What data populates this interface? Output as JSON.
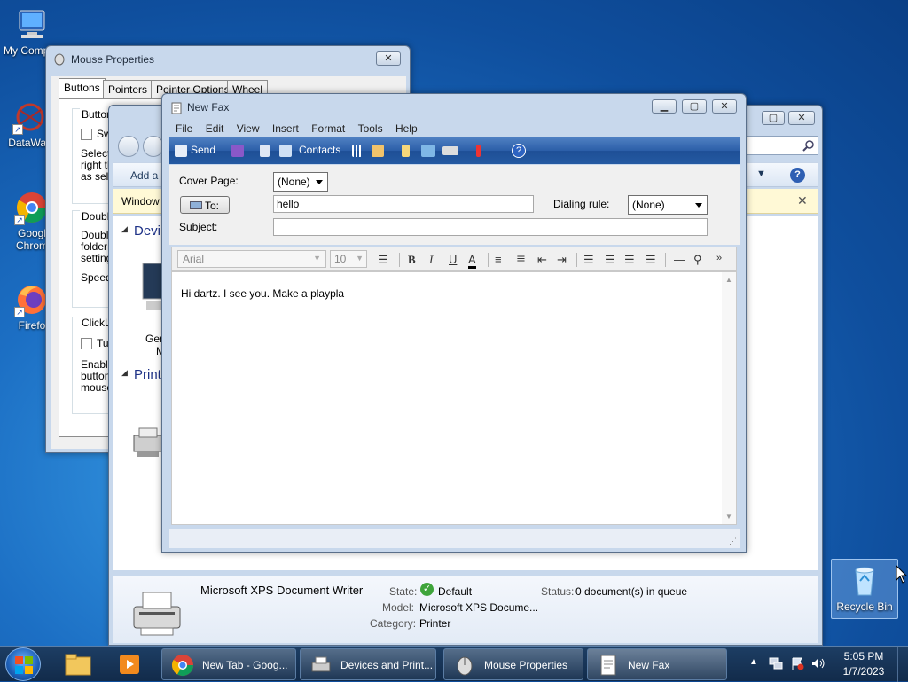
{
  "desktop": {
    "icons": [
      {
        "label": "My Comp"
      },
      {
        "label": "DataWag"
      },
      {
        "label": "Googl\nChrom"
      },
      {
        "label": "Firefo"
      },
      {
        "label": "Recycle Bin"
      }
    ]
  },
  "mouse_properties": {
    "title": "Mouse Properties",
    "tabs": [
      "Buttons",
      "Pointers",
      "Pointer Options",
      "Wheel"
    ],
    "group_button": "Button",
    "switch_label": "Swi",
    "select_text": [
      "Select",
      "right th",
      "as sele"
    ],
    "double_group": "Double",
    "double_text": [
      "Double",
      "folder c",
      "setting."
    ],
    "speed_label": "Speed:",
    "clicklock_group": "ClickLo",
    "turn_label": "Tur",
    "enable_text": [
      "Enable",
      "button.",
      "mouse"
    ]
  },
  "devices_printers": {
    "add_label": "Add a",
    "windows_bar": "Window",
    "devices_heading": "Devi",
    "printers_heading": "Printe",
    "device_label": [
      "Gen",
      "M"
    ],
    "details": {
      "name": "Microsoft XPS Document Writer",
      "state_label": "State:",
      "state_value": "Default",
      "status_label": "Status:",
      "status_value": "0 document(s) in queue",
      "model_label": "Model:",
      "model_value": "Microsoft XPS Docume...",
      "category_label": "Category:",
      "category_value": "Printer"
    }
  },
  "fax": {
    "title": "New Fax",
    "menu": [
      "File",
      "Edit",
      "View",
      "Insert",
      "Format",
      "Tools",
      "Help"
    ],
    "toolbar": {
      "send": "Send",
      "contacts": "Contacts"
    },
    "cover_page_label": "Cover Page:",
    "cover_page_value": "(None)",
    "to_button": "To:",
    "to_value": "hello",
    "dialing_rule_label": "Dialing rule:",
    "dialing_rule_value": "(None)",
    "subject_label": "Subject:",
    "subject_value": "",
    "font_name": "Arial",
    "font_size": "10",
    "body_text": "Hi dartz. I see you. Make a playpla"
  },
  "taskbar": {
    "buttons": [
      "New Tab - Goog...",
      "Devices and Print...",
      "Mouse Properties",
      "New Fax"
    ],
    "clock_time": "5:05 PM",
    "clock_date": "1/7/2023"
  }
}
